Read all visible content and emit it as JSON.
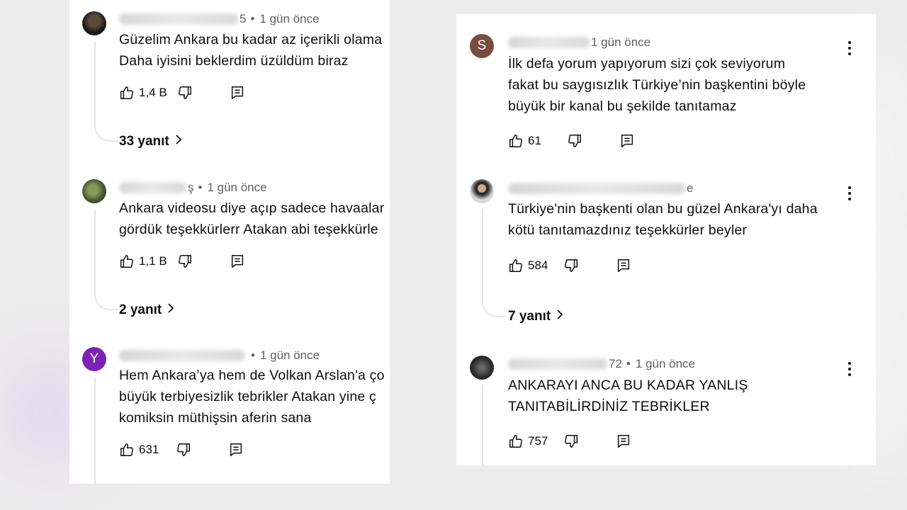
{
  "left_panel": {
    "comments": [
      {
        "time": "1 gün önce",
        "name_visible_fragment": "5",
        "lines": [
          "Güzelim Ankara bu kadar az içerikli olama",
          "Daha iyisini beklerdim üzüldüm biraz"
        ],
        "likes": "1,4 B",
        "replies": "33 yanıt"
      },
      {
        "time": "1 gün önce",
        "name_visible_fragment": "ş",
        "lines": [
          "Ankara videosu diye açıp sadece havaalar",
          "gördük teşekkürlerr Atakan abi teşekkürle"
        ],
        "likes": "1,1 B",
        "replies": "2 yanıt"
      },
      {
        "time": "1 gün önce",
        "avatar_letter": "Y",
        "lines": [
          "Hem Ankara’ya hem de Volkan Arslan'a ço",
          "büyük terbiyesizlik tebrikler Atakan yine ç",
          "komiksin müthişsin aferin sana"
        ],
        "likes": "631"
      }
    ]
  },
  "right_panel": {
    "comments": [
      {
        "time": "1 gün önce",
        "avatar_letter": "S",
        "lines": [
          "İlk defa yorum yapıyorum sizi çok seviyorum",
          "fakat bu saygısızlık Türkiye’nin başkentini böyle",
          "büyük bir kanal bu şekilde tanıtamaz"
        ],
        "likes": "61"
      },
      {
        "time_fragment": "e",
        "lines": [
          "Türkiye'nin başkenti olan bu güzel Ankara'yı daha",
          "kötü tanıtamazdınız teşekkürler beyler"
        ],
        "likes": "584",
        "replies": "7 yanıt"
      },
      {
        "time": "1 gün önce",
        "name_visible_fragment": "72",
        "lines": [
          "ANKARAYI ANCA BU KADAR YANLIŞ",
          "TANITABİLİRDİNİZ TEBRİKLER"
        ],
        "likes": "757"
      }
    ]
  },
  "icons": {
    "like": "thumbs-up-icon",
    "dislike": "thumbs-down-icon",
    "reply": "comment-reply-icon",
    "more": "more-vert-icon",
    "chevron": "chevron-right-icon"
  },
  "colors": {
    "avatar_y": "#7b22b4",
    "avatar_s": "#7a4b3f",
    "thread_line": "#e5e5e5",
    "meta_text": "#606060"
  }
}
